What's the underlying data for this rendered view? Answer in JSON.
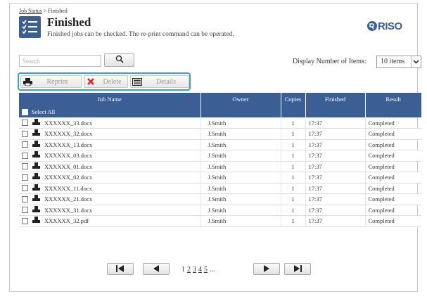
{
  "breadcrumb": {
    "link": "Job Status",
    "separator": ">",
    "current": "Finished"
  },
  "page": {
    "title": "Finished",
    "subtitle": "Finished jobs can be checked. The re-print command can be operated."
  },
  "brand": {
    "logo": "RISO",
    "color": "#3b5f95"
  },
  "search": {
    "placeholder": "Search",
    "button_icon": "search-icon"
  },
  "display": {
    "label": "Display Number of Items:",
    "selected": "10 items"
  },
  "toolbar": {
    "reprint": "Reprint",
    "delete": "Delete",
    "details": "Details",
    "highlight_color": "#3b9ed8"
  },
  "table": {
    "headers": {
      "job_name": "Job Name",
      "owner": "Owner",
      "copies": "Copies",
      "finished": "Finished",
      "result": "Result"
    },
    "select_all": "Select All",
    "rows": [
      {
        "name": "XXXXXX_33.docx",
        "owner": "J.Smith",
        "copies": "1",
        "finished": "17:37",
        "result": "Completed"
      },
      {
        "name": "XXXXXX_32.docx",
        "owner": "J.Smith",
        "copies": "1",
        "finished": "17:37",
        "result": "Completed"
      },
      {
        "name": "XXXXXX_13.docx",
        "owner": "J.Smith",
        "copies": "1",
        "finished": "17:37",
        "result": "Completed"
      },
      {
        "name": "XXXXXX_03.docx",
        "owner": "J.Smith",
        "copies": "1",
        "finished": "17:37",
        "result": "Completed"
      },
      {
        "name": "XXXXXX_01.docx",
        "owner": "J.Smith",
        "copies": "1",
        "finished": "17:37",
        "result": "Completed"
      },
      {
        "name": "XXXXXX_02.docx",
        "owner": "J.Smith",
        "copies": "1",
        "finished": "17:37",
        "result": "Completed"
      },
      {
        "name": "XXXXXX_11.docx",
        "owner": "J.Smith",
        "copies": "1",
        "finished": "17:37",
        "result": "Completed"
      },
      {
        "name": "XXXXXX_21.docx",
        "owner": "J.Smith",
        "copies": "1",
        "finished": "17:37",
        "result": "Completed"
      },
      {
        "name": "XXXXXX_31.docx",
        "owner": "J.Smith",
        "copies": "1",
        "finished": "17:37",
        "result": "Completed"
      },
      {
        "name": "XXXXXX_32.pdf",
        "owner": "J.Smith",
        "copies": "1",
        "finished": "17:37",
        "result": "Completed"
      }
    ]
  },
  "pagination": {
    "pages": [
      "1",
      "2",
      "3",
      "4",
      "5"
    ],
    "ellipsis": "...",
    "current": "1"
  }
}
